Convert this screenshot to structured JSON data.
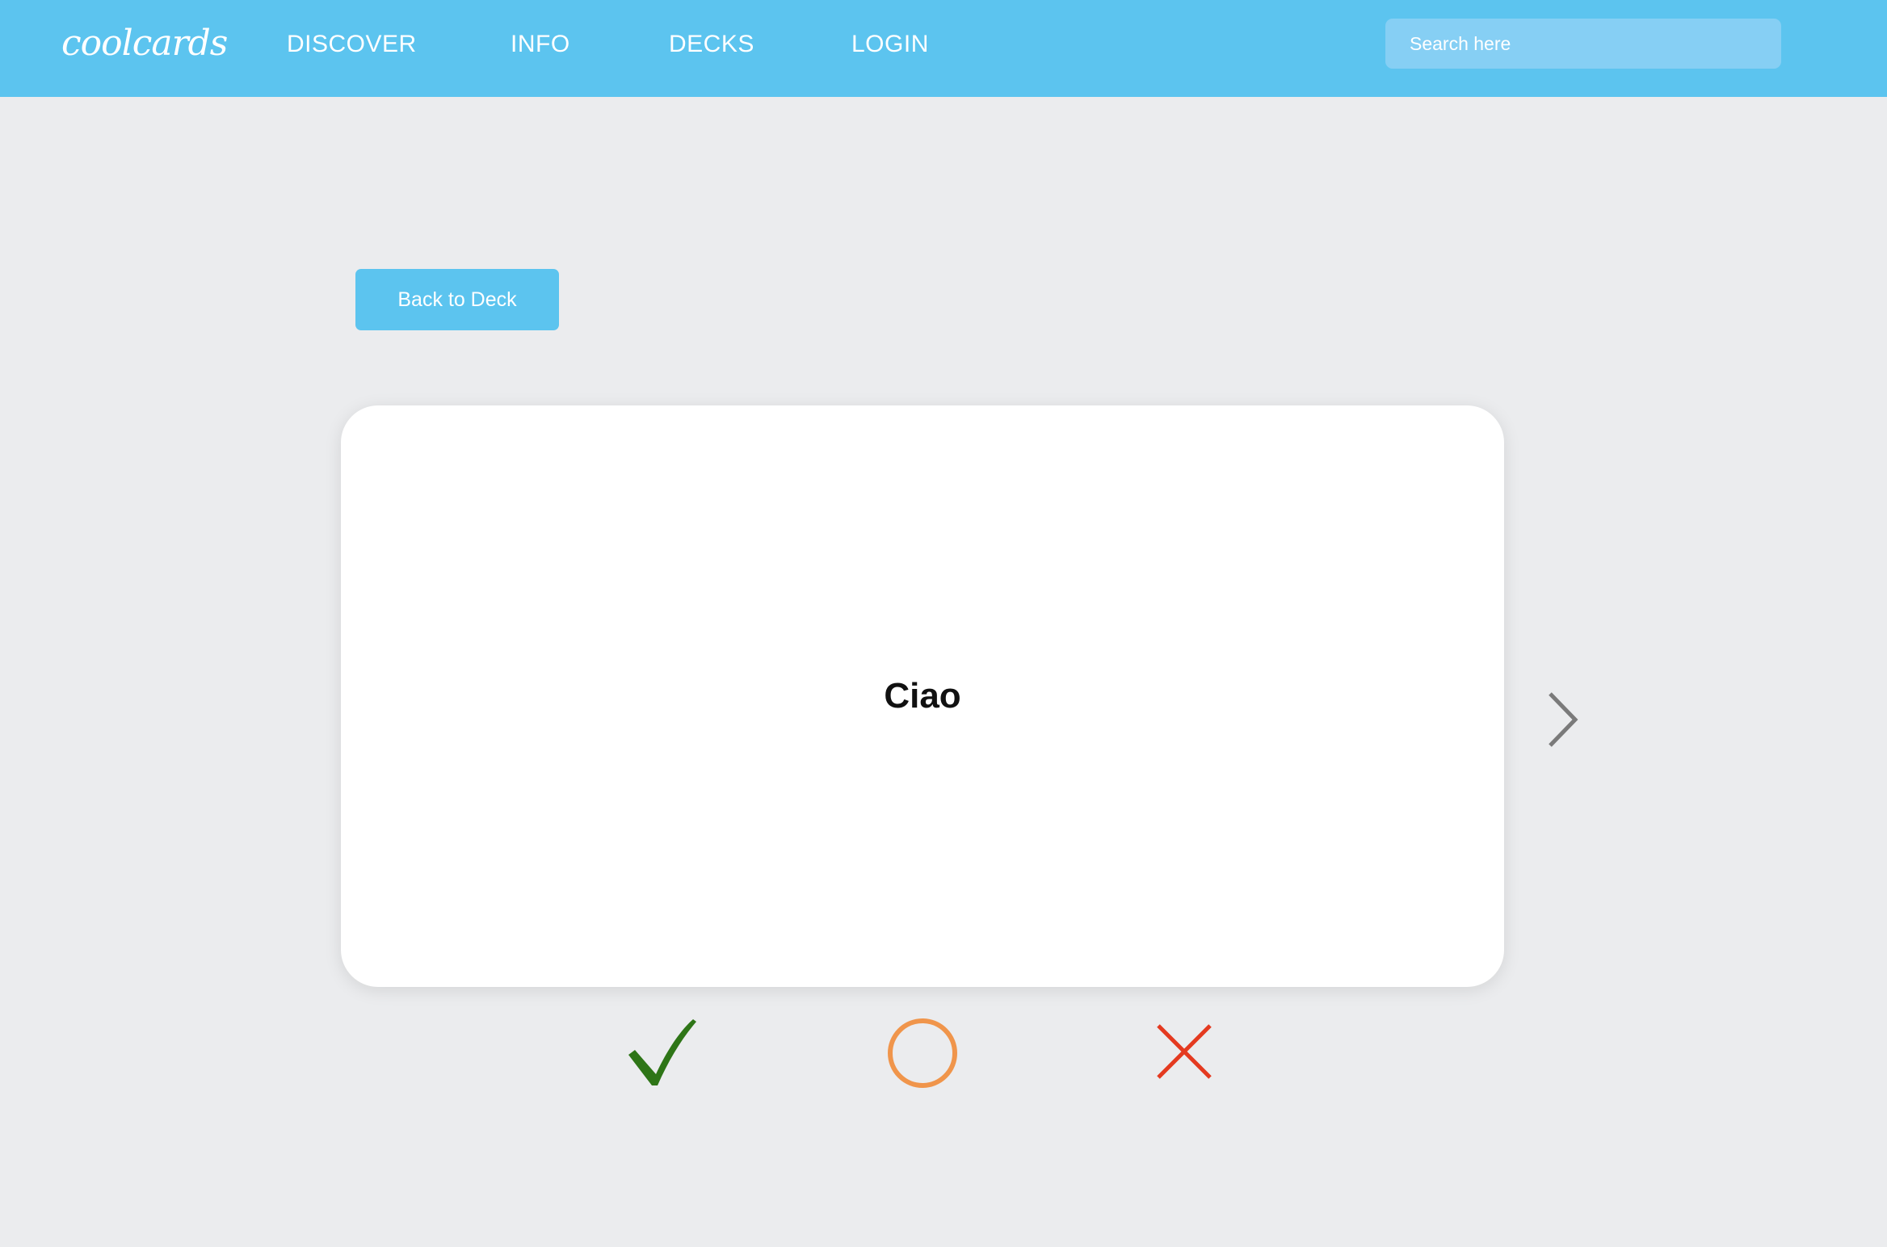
{
  "app": {
    "logo_text": "coolcards"
  },
  "nav": {
    "items": [
      {
        "label": "DISCOVER"
      },
      {
        "label": "INFO"
      },
      {
        "label": "DECKS"
      },
      {
        "label": "LOGIN"
      }
    ]
  },
  "search": {
    "placeholder": "Search here",
    "value": ""
  },
  "study": {
    "back_button_label": "Back to Deck",
    "card_term": "Ciao",
    "next_icon": "chevron-right-icon",
    "rating_icons": [
      "checkmark-icon",
      "circle-icon",
      "x-icon"
    ]
  },
  "colors": {
    "accent": "#5CC4EF",
    "background": "#EBECEE",
    "correct": "#2E7517",
    "partial": "#F0954B",
    "wrong": "#E43A20",
    "arrow": "#7A7A7A"
  }
}
